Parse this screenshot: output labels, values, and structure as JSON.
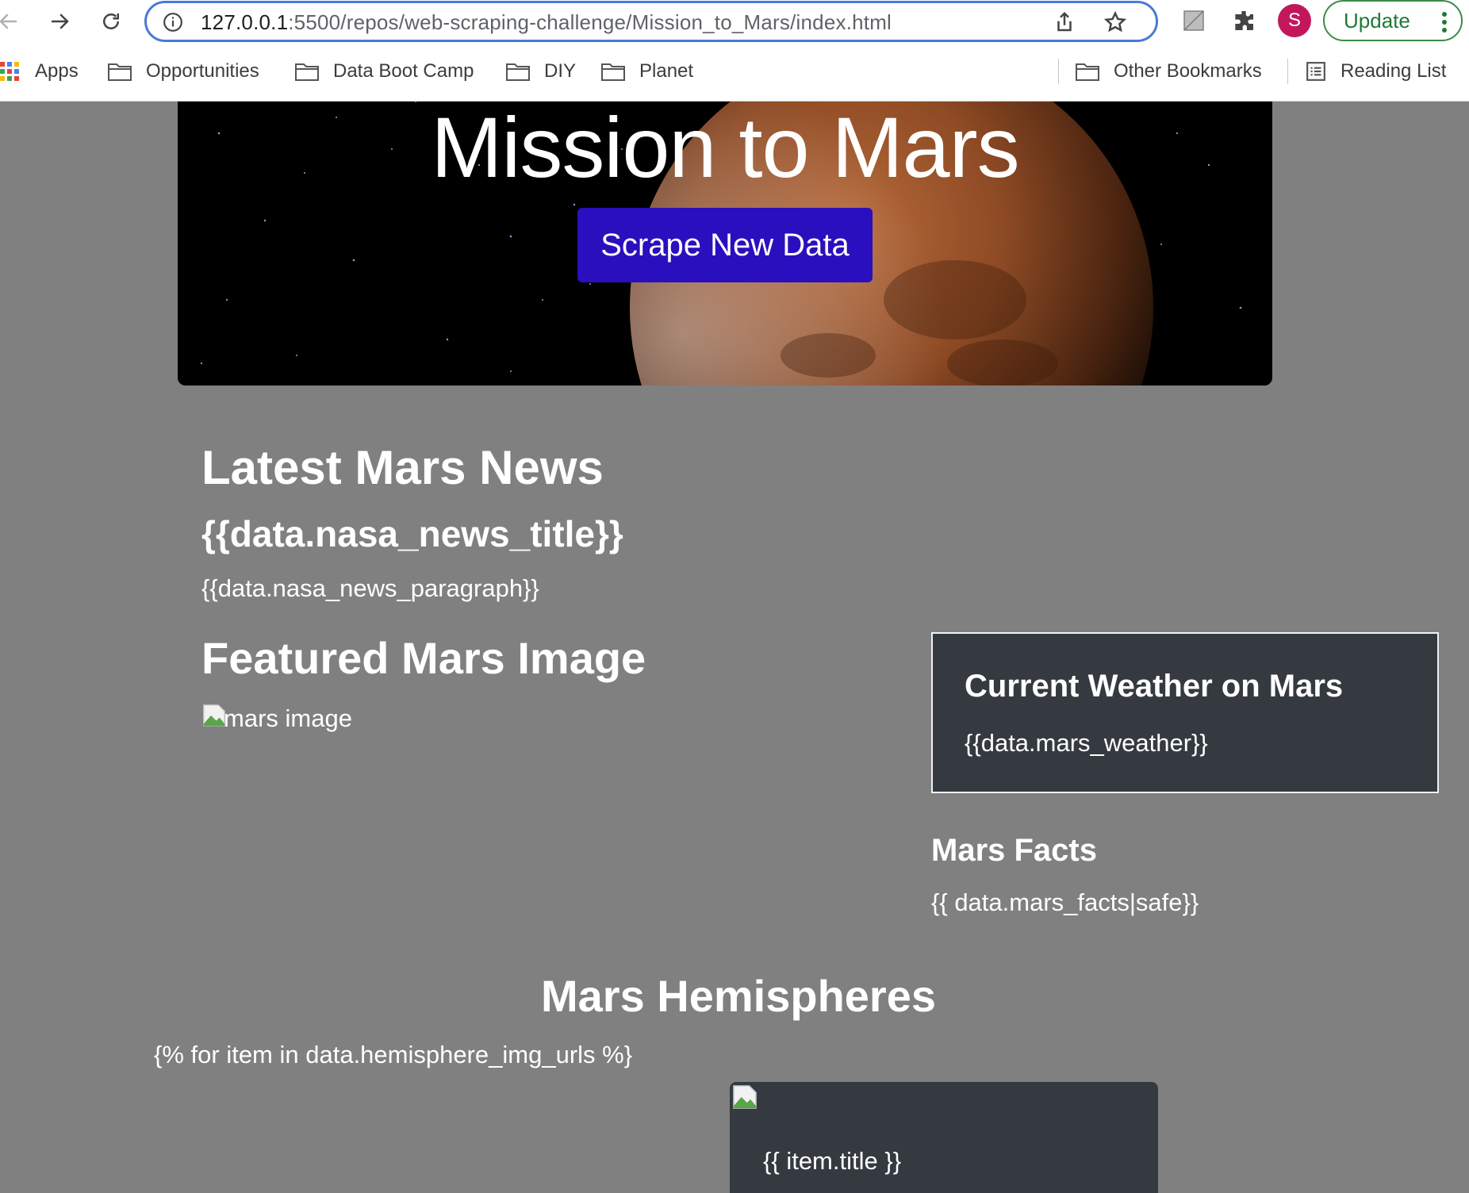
{
  "browser": {
    "url_host": "127.0.0.1",
    "url_path": ":5500/repos/web-scraping-challenge/Mission_to_Mars/index.html",
    "avatar_letter": "S",
    "update_label": "Update",
    "bookmarks": [
      {
        "label": "Apps",
        "icon": "apps-grid-icon"
      },
      {
        "label": "Opportunities",
        "icon": "folder-icon"
      },
      {
        "label": "Data Boot Camp",
        "icon": "folder-icon"
      },
      {
        "label": "DIY",
        "icon": "folder-icon"
      },
      {
        "label": "Planet",
        "icon": "folder-icon"
      },
      {
        "label": "Other Bookmarks",
        "icon": "folder-icon"
      },
      {
        "label": "Reading List",
        "icon": "reading-list-icon"
      }
    ]
  },
  "hero": {
    "title": "Mission to Mars",
    "button_label": "Scrape New Data"
  },
  "news": {
    "heading": "Latest Mars News",
    "title": "{{data.nasa_news_title}}",
    "paragraph": "{{data.nasa_news_paragraph}}"
  },
  "featured": {
    "heading": "Featured Mars Image",
    "img_alt": "mars image"
  },
  "weather": {
    "heading": "Current Weather on Mars",
    "value": "{{data.mars_weather}}"
  },
  "facts": {
    "heading": "Mars Facts",
    "value": "{{ data.mars_facts|safe}}"
  },
  "hemispheres": {
    "heading": "Mars Hemispheres",
    "loop_text": "{% for item in data.hemisphere_img_urls %}",
    "item_title": "{{ item.title }}"
  },
  "colors": {
    "page_bg": "#808080",
    "button_bg": "#2a0fbe",
    "card_bg": "#343a40",
    "omnibox_border": "#4a79d8",
    "update_green": "#1e7a35"
  }
}
